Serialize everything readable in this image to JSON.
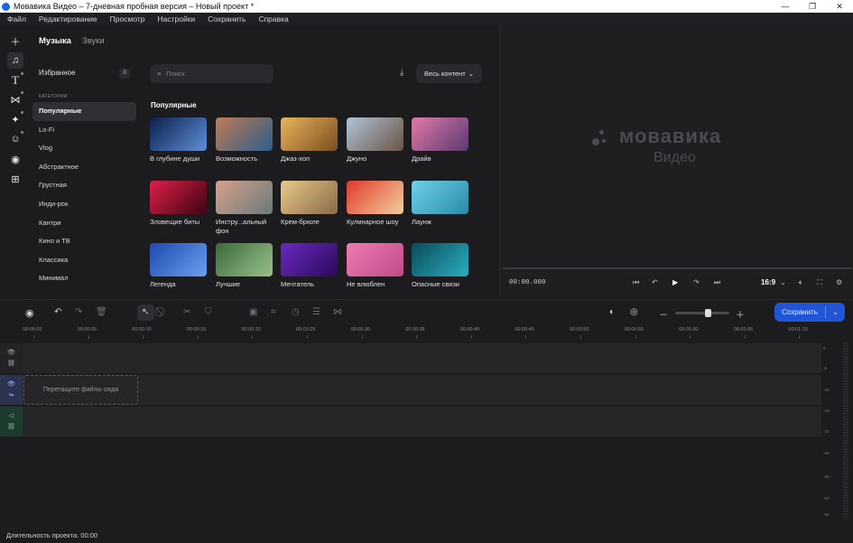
{
  "window": {
    "title": "Мовавика Видео – 7-дневная пробная версия – Новый проект *"
  },
  "menu": [
    "Файл",
    "Редактирование",
    "Просмотр",
    "Настройки",
    "Сохранить",
    "Справка"
  ],
  "left_tools": [
    "plus-icon",
    "music-icon",
    "text-icon",
    "transitions-icon",
    "magic-wand-icon",
    "sticker-icon",
    "record-icon",
    "more-tools-icon"
  ],
  "panel": {
    "tabs": [
      "Музыка",
      "Звуки"
    ],
    "favorites": {
      "label": "Избранное",
      "count": "0"
    },
    "categories_heading": "КАТЕГОРИИ",
    "categories": [
      "Популярные",
      "Lo-Fi",
      "Vlog",
      "Абстрактное",
      "Грустная",
      "Инди-рок",
      "Кантри",
      "Кино и ТВ",
      "Классика",
      "Минимал"
    ],
    "search": {
      "placeholder": "Поиск",
      "value": ""
    },
    "filter_label": "Весь контент",
    "section_title": "Популярные",
    "tracks": [
      {
        "label": "В глубине души",
        "c1": "#0b1f4a",
        "c2": "#5f8fd9"
      },
      {
        "label": "Возможность",
        "c1": "#c27a56",
        "c2": "#2a5f8a"
      },
      {
        "label": "Джаз-хоп",
        "c1": "#e8b45a",
        "c2": "#7a4e20"
      },
      {
        "label": "Джуно",
        "c1": "#b0c4d6",
        "c2": "#6a5346"
      },
      {
        "label": "Драйв",
        "c1": "#e07aa8",
        "c2": "#5b3a70"
      },
      {
        "label": "Зловещие биты",
        "c1": "#e0204a",
        "c2": "#3a0510"
      },
      {
        "label": "Инстру...альный фон",
        "c1": "#d6a08c",
        "c2": "#6a7a7a"
      },
      {
        "label": "Крем-брюле",
        "c1": "#e8c98a",
        "c2": "#8a6a46"
      },
      {
        "label": "Кулинарное шоу",
        "c1": "#e03a2a",
        "c2": "#f0d0a0"
      },
      {
        "label": "Лаунж",
        "c1": "#6ed2e8",
        "c2": "#2a8aa8"
      },
      {
        "label": "Легенда",
        "c1": "#1e4ab0",
        "c2": "#6aa0f0"
      },
      {
        "label": "Лучшие",
        "c1": "#3a6a3a",
        "c2": "#9ac08a"
      },
      {
        "label": "Мечтатель",
        "c1": "#6a2ac0",
        "c2": "#2a0a5a"
      },
      {
        "label": "Не влюблен",
        "c1": "#f07ab0",
        "c2": "#c04a8a"
      },
      {
        "label": "Опасные связи",
        "c1": "#0a4a5a",
        "c2": "#2ab0c0"
      }
    ]
  },
  "preview": {
    "brand": "мовавика",
    "brand_sub": "Видео",
    "time": "00:00.000",
    "aspect": "16:9",
    "aspect_arrow": "⌄"
  },
  "toolbar": {
    "save_label": "Сохранить",
    "save_arrow": "⌄"
  },
  "ruler": [
    "00:00:00",
    "00:00:05",
    "00:00:10",
    "00:00:15",
    "00:00:20",
    "00:00:25",
    "00:00:30",
    "00:00:35",
    "00:00:40",
    "00:00:45",
    "00:00:50",
    "00:00:55",
    "00:01:00",
    "00:01:05",
    "00:01:10"
  ],
  "timeline": {
    "drop_hint": "Перетащите файлы сюда"
  },
  "meter_labels": [
    "0",
    "-5",
    "-10",
    "-15",
    "-20",
    "-30",
    "-40",
    "-50",
    "-60"
  ],
  "status": {
    "duration": "Длительность проекта: 00:00"
  }
}
